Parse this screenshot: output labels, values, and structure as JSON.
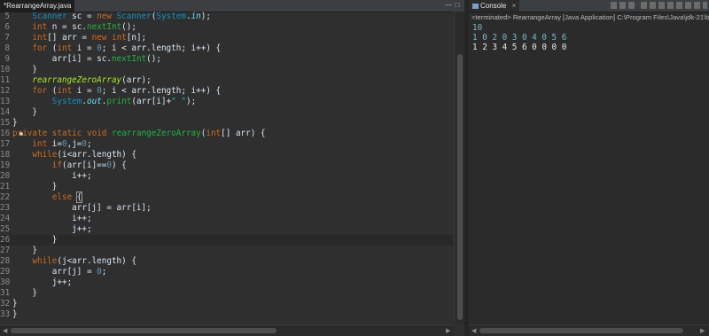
{
  "editor": {
    "tab_label": "*RearrangeArray.java",
    "lines": [
      {
        "n": "5",
        "c": "    Scanner sc = new Scanner(System.in);"
      },
      {
        "n": "6",
        "c": "    int n = sc.nextInt();"
      },
      {
        "n": "7",
        "c": "    int[] arr = new int[n];"
      },
      {
        "n": "8",
        "c": "    for (int i = 0; i < arr.length; i++) {"
      },
      {
        "n": "9",
        "c": "        arr[i] = sc.nextInt();"
      },
      {
        "n": "10",
        "c": "    }"
      },
      {
        "n": "11",
        "c": "    rearrangeZeroArray(arr);"
      },
      {
        "n": "12",
        "c": "    for (int i = 0; i < arr.length; i++) {"
      },
      {
        "n": "13",
        "c": "        System.out.print(arr[i]+\" \");"
      },
      {
        "n": "14",
        "c": "    }"
      },
      {
        "n": "15",
        "c": "}"
      },
      {
        "n": "16",
        "c": "private static void rearrangeZeroArray(int[] arr) {"
      },
      {
        "n": "17",
        "c": "    int i=0,j=0;"
      },
      {
        "n": "18",
        "c": "    while(i<arr.length) {"
      },
      {
        "n": "19",
        "c": "        if(arr[i]==0) {"
      },
      {
        "n": "20",
        "c": "            i++;"
      },
      {
        "n": "21",
        "c": "        }"
      },
      {
        "n": "22",
        "c": "        else {"
      },
      {
        "n": "23",
        "c": "            arr[j] = arr[i];"
      },
      {
        "n": "24",
        "c": "            i++;"
      },
      {
        "n": "25",
        "c": "            j++;"
      },
      {
        "n": "26",
        "c": "        }"
      },
      {
        "n": "27",
        "c": "    }"
      },
      {
        "n": "28",
        "c": "    while(j<arr.length) {"
      },
      {
        "n": "29",
        "c": "        arr[j] = 0;"
      },
      {
        "n": "30",
        "c": "        j++;"
      },
      {
        "n": "31",
        "c": "    }"
      },
      {
        "n": "32",
        "c": "}"
      },
      {
        "n": "33",
        "c": "}"
      }
    ],
    "current_line": "26"
  },
  "console": {
    "tab_label": "Console",
    "status": "<terminated> RearrangeArray [Java Application] C:\\Program Files\\Java\\jdk-21\\b",
    "input_lines": [
      "10",
      "1 0 2 0 3 0 4 0 5 6"
    ],
    "output_lines": [
      "1 2 3 4 5 6 0 0 0 0"
    ]
  },
  "colors": {
    "editor_bg": "#2f2f2f",
    "keyword": "#cc6c1d",
    "type": "#1290c3",
    "method": "#1eb540",
    "number": "#6897bb",
    "string": "#17c6a3",
    "console_input": "#78b7c8"
  },
  "icons": [
    "close-icon",
    "minimize-icon",
    "maximize-icon",
    "console-icon",
    "clear-console-icon",
    "scroll-lock-icon",
    "pin-icon",
    "display-console-icon"
  ]
}
